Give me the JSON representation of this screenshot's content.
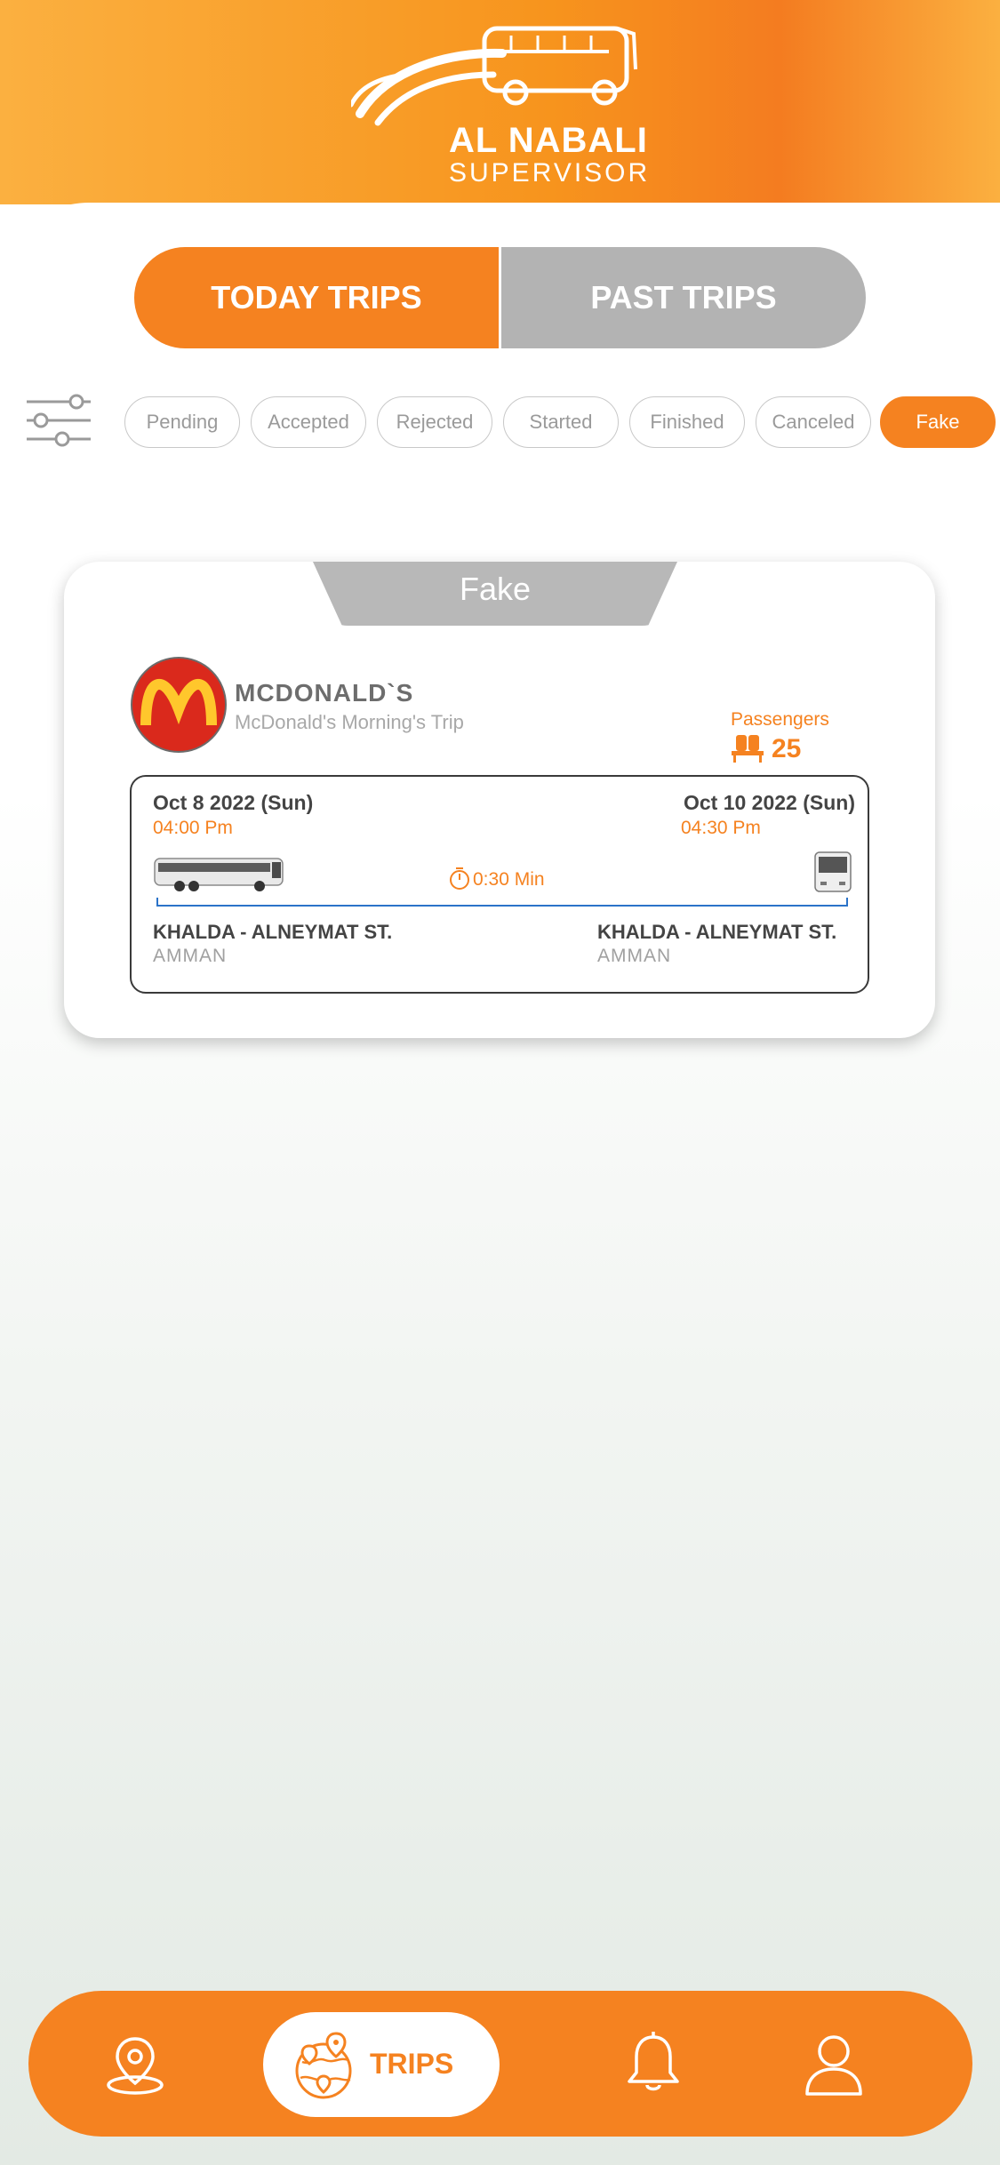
{
  "header": {
    "brand_title": "AL NABALI",
    "brand_subtitle": "SUPERVISOR",
    "gradient_colors": [
      "#fbb040",
      "#f7941d",
      "#f47c20"
    ]
  },
  "segments": {
    "today_label": "TODAY TRIPS",
    "past_label": "PAST TRIPS",
    "selected": "TODAY TRIPS"
  },
  "filters": {
    "chips": [
      "Pending",
      "Accepted",
      "Rejected",
      "Started",
      "Finished",
      "Canceled",
      "Fake"
    ],
    "active": "Fake"
  },
  "trip_card": {
    "status_tab": "Fake",
    "company": "MCDONALD`S",
    "trip_name": "McDonald's Morning's Trip",
    "logo_text": "McDonald's",
    "passengers_label": "Passengers",
    "passengers_count": "25",
    "departure": {
      "date": "Oct 8 2022 (Sun)",
      "time": "04:00 Pm",
      "place": "KHALDA - ALNEYMAT ST.",
      "city": "AMMAN"
    },
    "arrival": {
      "date": "Oct 10 2022 (Sun)",
      "time": "04:30 Pm",
      "place": "KHALDA - ALNEYMAT ST.",
      "city": "AMMAN"
    },
    "duration": "0:30 Min"
  },
  "bottom_nav": {
    "items": [
      {
        "icon": "map-pin-icon"
      },
      {
        "icon": "globe-pins-icon",
        "label": "TRIPS",
        "active": true
      },
      {
        "icon": "bell-icon"
      },
      {
        "icon": "user-icon"
      }
    ],
    "accent": "#f58220"
  }
}
